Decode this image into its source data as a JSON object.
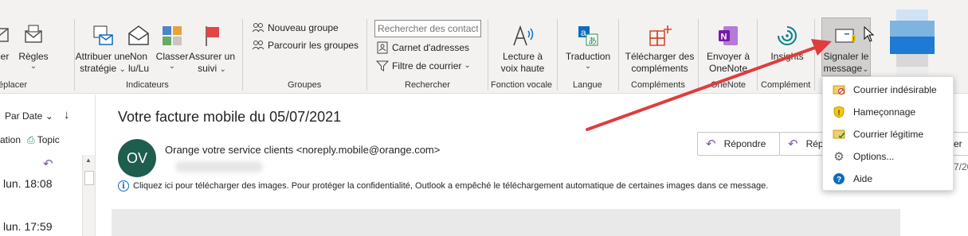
{
  "ribbon": {
    "buttons": {
      "move": "Déplacer",
      "rules": "Règles",
      "assign_policy": [
        "Attribuer une",
        "stratégie"
      ],
      "unread": [
        "Non",
        "lu/Lu"
      ],
      "categorize": "Classer",
      "follow_up": [
        "Assurer un",
        "suivi"
      ],
      "new_group": "Nouveau groupe",
      "browse_groups": "Parcourir les groupes",
      "search_contacts_placeholder": "Rechercher des contacts",
      "address_book": "Carnet d'adresses",
      "filter_mail": "Filtre de courrier",
      "read_aloud": [
        "Lecture à",
        "voix haute"
      ],
      "translate": "Traduction",
      "get_addins": [
        "Télécharger des",
        "compléments"
      ],
      "send_onenote": [
        "Envoyer à",
        "OneNote"
      ],
      "insights": "Insights",
      "report_message": [
        "Signaler le",
        "message"
      ]
    },
    "groups": {
      "move": "éplacer",
      "tags": "Indicateurs",
      "groups": "Groupes",
      "find": "Rechercher",
      "speech": "Fonction vocale",
      "language": "Langue",
      "addins": "Compléments",
      "onenote": "OneNote",
      "addin": "Complément"
    }
  },
  "list_pane": {
    "sort_label": "Par Date",
    "view_fragment": "ation",
    "topic_label": "Topic",
    "items": [
      {
        "time": "lun. 18:08"
      },
      {
        "time": "lun. 17:59"
      }
    ]
  },
  "message": {
    "subject": "Votre facture mobile du 05/07/2021",
    "avatar_initials": "OV",
    "sender": "Orange votre service clients <noreply.mobile@orange.com>",
    "info_text": "Cliquez ici pour télécharger des images. Pour protéger la confidentialité, Outlook a empêché le téléchargement automatique de certaines images dans ce message.",
    "actions": {
      "reply": "Répondre",
      "reply_all_fragment": "Rép",
      "forward_fragment": "er",
      "date_fragment": "7/20"
    }
  },
  "report_menu": {
    "items": [
      {
        "label": "Courrier indésirable",
        "icon": "junk-icon"
      },
      {
        "label": "Hameçonnage",
        "icon": "phishing-shield-icon"
      },
      {
        "label": "Courrier légitime",
        "icon": "not-junk-icon"
      },
      {
        "label": "Options...",
        "icon": "gear-icon"
      },
      {
        "label": "Aide",
        "icon": "help-icon"
      }
    ]
  },
  "colors": {
    "ribbon_bg": "#f3f2f1",
    "accent_blue": "#0f6cbd",
    "avatar_bg": "#1e5e4e",
    "annotation_arrow": "#e03c3c",
    "reply_icon": "#7a54a8"
  }
}
